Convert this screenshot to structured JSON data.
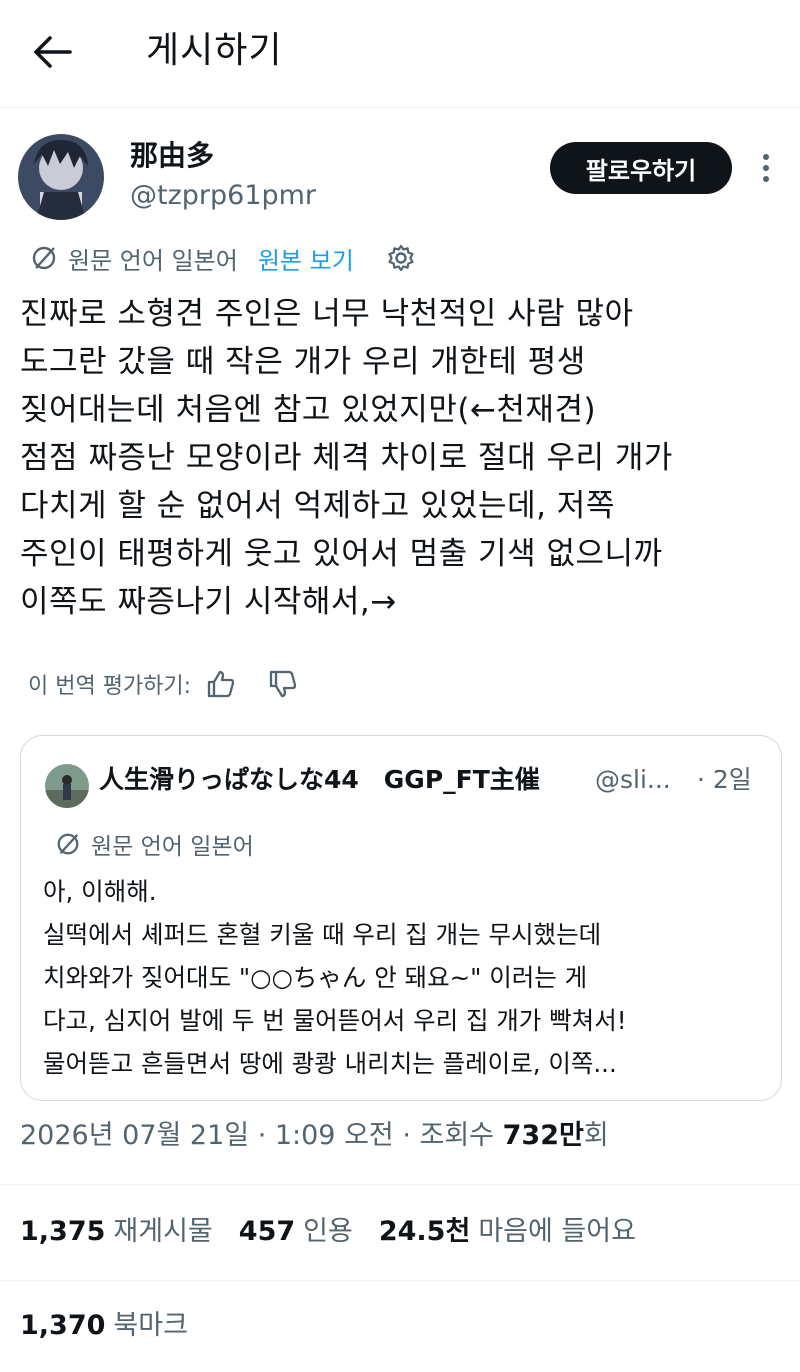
{
  "header": {
    "title": "게시하기"
  },
  "author": {
    "display_name": "那由多",
    "handle": "@tzprp61pmr"
  },
  "follow_label": "팔로우하기",
  "translation": {
    "label": "원문 언어 일본어",
    "show_original": "원본 보기"
  },
  "tweet_lines": [
    "진짜로 소형견 주인은 너무 낙천적인 사람 많아",
    "도그란 갔을 때 작은 개가 우리 개한테 평생",
    "짖어대는데 처음엔 참고 있었지만(←천재견)",
    "점점 짜증난 모양이라 체격 차이로 절대 우리 개가",
    "다치게 할 순 없어서 억제하고 있었는데, 저쪽",
    "주인이 태평하게 웃고 있어서 멈출 기색 없으니까",
    "이쪽도 짜증나기 시작해서,→"
  ],
  "rate_translation_label": "이 번역 평가하기:",
  "quote": {
    "name": "人生滑りっぱなしな44　GGP_FT主催",
    "handle": "@sli...",
    "time": "· 2일",
    "translation_label": "원문 언어 일본어",
    "lines": [
      "아, 이해해.",
      "실떡에서 셰퍼드 혼혈 키울 때 우리 집 개는 무시했는데",
      "치와와가 짖어대도 \"○○ちゃん 안 돼요~\" 이러는 게",
      "다고, 심지어 발에 두 번 물어뜯어서 우리 집 개가 빡쳐서!",
      "물어뜯고 흔들면서 땅에 쾅쾅 내리치는 플레이로, 이쪽..."
    ]
  },
  "meta": {
    "timestamp": "2026년 07월 21일 · 1:09 오전 · 조회수",
    "views_value": "732만",
    "views_suffix": "회"
  },
  "stats": {
    "reposts_value": "1,375",
    "reposts_label": "재게시물",
    "quotes_value": "457",
    "quotes_label": "인용",
    "likes_value": "24.5천",
    "likes_label": "마음에 들어요",
    "bookmarks_value": "1,370",
    "bookmarks_label": "북마크"
  },
  "colors": {
    "accent": "#1d9bf0",
    "text": "#0f1419",
    "muted": "#536471",
    "border": "#cfd9de",
    "button": "#0f1419"
  },
  "icons": [
    "back-arrow-icon",
    "more-icon",
    "translate-icon",
    "settings-icon",
    "thumbs-up-icon",
    "thumbs-down-icon"
  ]
}
